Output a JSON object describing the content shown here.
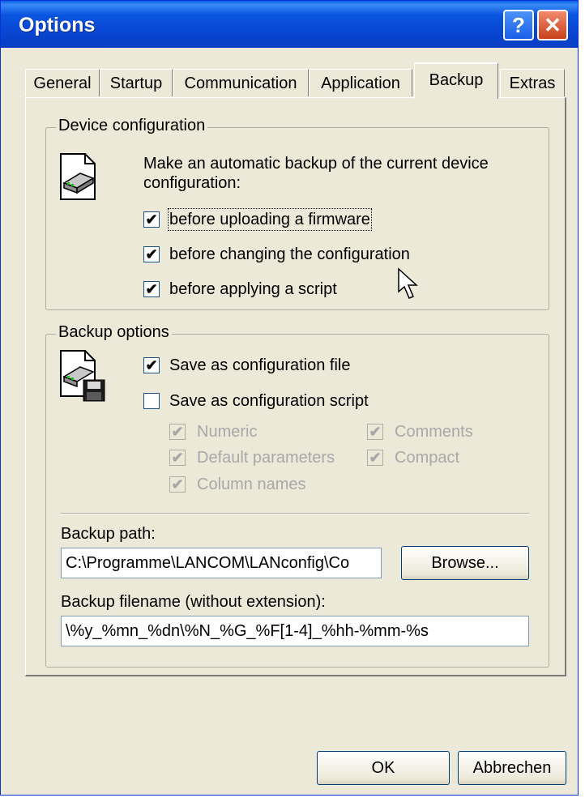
{
  "window": {
    "title": "Options",
    "help_glyph": "?",
    "close_glyph": "✕"
  },
  "tabs": [
    {
      "label": "General"
    },
    {
      "label": "Startup"
    },
    {
      "label": "Communication"
    },
    {
      "label": "Application"
    },
    {
      "label": "Backup"
    },
    {
      "label": "Extras"
    }
  ],
  "active_tab": "Backup",
  "device_configuration": {
    "title": "Device configuration",
    "description": "Make an automatic backup of the current device configuration:",
    "options": [
      {
        "label": "before uploading a firmware",
        "checked": true
      },
      {
        "label": "before changing the configuration",
        "checked": true
      },
      {
        "label": "before applying a script",
        "checked": true
      }
    ]
  },
  "backup_options": {
    "title": "Backup options",
    "save_as_file": {
      "label": "Save as configuration file",
      "checked": true
    },
    "save_as_script": {
      "label": "Save as configuration script",
      "checked": false
    },
    "script_options": [
      {
        "label": "Numeric",
        "checked": true,
        "enabled": false
      },
      {
        "label": "Comments",
        "checked": true,
        "enabled": false
      },
      {
        "label": "Default parameters",
        "checked": true,
        "enabled": false
      },
      {
        "label": "Compact",
        "checked": true,
        "enabled": false
      },
      {
        "label": "Column names",
        "checked": true,
        "enabled": false
      }
    ],
    "backup_path_label": "Backup path:",
    "backup_path_value": "C:\\Programme\\LANCOM\\LANconfig\\Co",
    "browse_label": "Browse...",
    "filename_label": "Backup filename (without extension):",
    "filename_value": "\\%y_%mn_%dn\\%N_%G_%F[1-4]_%hh-%mm-%s"
  },
  "footer": {
    "ok_label": "OK",
    "cancel_label": "Abbrechen"
  },
  "check_glyph": "✔"
}
